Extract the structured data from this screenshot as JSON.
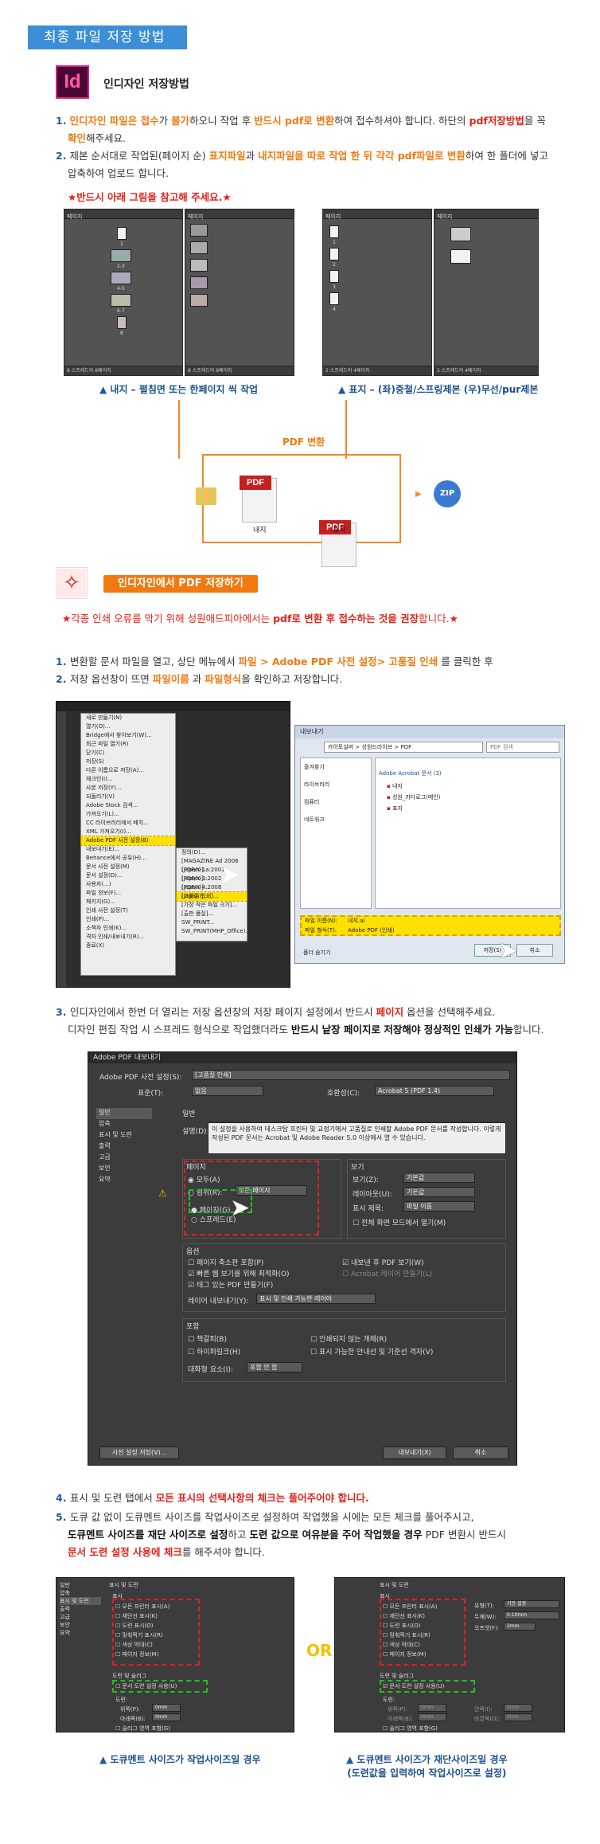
{
  "header": {
    "title": "최종 파일 저장 방법"
  },
  "section1": {
    "logo_text": "Id",
    "title": "인디자인 저장방법",
    "items": [
      {
        "num": "1.",
        "p1": "인디자인 파일은 접수",
        "p2": "가 ",
        "p3": "불가",
        "p4": "하오니 작업 후 ",
        "p5": "반드시 pdf로 변환",
        "p6": "하여 접수하셔야 합니다. 하단의 ",
        "p7": "pdf저장방법",
        "p8": "을 꼭",
        "p9": "확인",
        "p10": "해주세요."
      },
      {
        "num": "2.",
        "p1": "제본 순서대로 작업된(페이지 순) ",
        "p2": "표지파일",
        "p3": "과 ",
        "p4": "내지파일을 따로 작업 한 뒤 각각 pdf파일로 변환",
        "p5": "하여 한 폴더에 넣고",
        "p6": "압축하여 업로드 합니다."
      }
    ],
    "note": "★반드시 아래 그림을 참고해 주세요.★",
    "panel_tab1": "페이지",
    "panel_tab2": "링크",
    "panel_footer_left": "8 스프레드의 8페이지",
    "panel_footer_right": "2 스프레드의 4페이지",
    "inner_pages": [
      "1",
      "2-3",
      "4-5",
      "6-7",
      "8"
    ],
    "cover_pages": [
      "1",
      "2",
      "3",
      "4"
    ],
    "caption_left_a": "▲ ",
    "caption_left_b": "내지",
    "caption_left_c": " – 펼침면 또는 한페이지 씩 작업",
    "caption_right_a": "▲ ",
    "caption_right_b": "표지",
    "caption_right_c": " – (좌)중철/스프링제본  (우)무선/pur제본",
    "convert_label": "PDF 변환",
    "pdf_tag": "PDF",
    "pdf1_label": "내지",
    "pdf2_label": "표지",
    "zip_label": "ZIP"
  },
  "section2": {
    "title": "인디자인에서 PDF 저장하기",
    "warn_a": "★각종 인쇄 오류를 막기 위해 성원애드피아에서는 ",
    "warn_b": "pdf로 변환 후 접수하는 것을 권장",
    "warn_c": "합니다.★",
    "step1_a": "1. ",
    "step1_b": "변환할 문서 파일을 열고, 상단 메뉴에서 ",
    "step1_c": "파일 > Adobe PDF 사전 설정> 고품질 인쇄",
    "step1_d": " 를  클릭한 후",
    "step2_a": "2. ",
    "step2_b": "저장 옵션창이 뜨면 ",
    "step2_c": "파일이름",
    "step2_d": " 과 ",
    "step2_e": "파일형식",
    "step2_f": "을 확인하고 저장합니다.",
    "menu_items": [
      "새로 만들기(N)",
      "열기(O)...",
      "Bridge에서 찾아보기(W)...",
      "최근 파일 열기(R)",
      "닫기(C)",
      "저장(S)",
      "다른 이름으로 저장(A)...",
      "체크인(I)...",
      "사본 저장(Y)...",
      "되돌리기(V)",
      "Adobe Stock 검색...",
      "가져오기(L)...",
      "CC 라이브러리에서 배치...",
      "XML 가져오기(I)...",
      "Adobe PDF 사전 설정(B)",
      "내보내기(E)...",
      "Behance에서 공유(H)...",
      "문서 사전 설정(M)",
      "문서 설정(D)...",
      "사용자(...)",
      "파일 정보(F)...",
      "패키지(G)...",
      "인쇄 사전 설정(T)",
      "인쇄(P)...",
      "소책자 인쇄(K)...",
      "격자 인쇄/내보내기(R)...",
      "종료(X)"
    ],
    "submenu_items": [
      "정의(D)...",
      "[MAGAZINE Ad 2006 (Japan)]...",
      "[PDF/X-1a:2001 (Japan)]...",
      "[PDF/X-3:2002 (Japan)]...",
      "[PDF/X-4:2008 (Japan)]...",
      "[고품질 인쇄]...",
      "[가장 작은 파일 크기]...",
      "[출판 품질]...",
      "SW_PRINT...",
      "SW_PRINT(MHP_Office)..."
    ],
    "save_title": "내보내기",
    "save_path": "카이토실버 > 성원드라이브 > PDF",
    "save_search": "PDF 검색",
    "save_sidebar": [
      "즐겨찾기",
      "라이브러리",
      "컴퓨터",
      "네트워크"
    ],
    "save_group": "Adobe Acrobat 문서 (3)",
    "save_files": [
      "내지",
      "성원_카다로그(메인)",
      "표지"
    ],
    "filename_label": "파일 이름(N):",
    "filename_value": "내지.ai",
    "filetype_label": "파일 형식(T):",
    "filetype_value": "Adobe PDF (인쇄)",
    "save_btn": "저장(S)",
    "cancel_btn": "취소",
    "hide_folders": "폴더 숨기기"
  },
  "section3": {
    "step3_a": "3. ",
    "step3_b": "인디자인에서 한번 더 열리는 저장 옵션창의 저장 페이지 설정에서 반드시 ",
    "step3_c": "페이지",
    "step3_d": " 옵션을 선택해주세요.",
    "step3_e": "디자인 편집 작업 시 스프레드 형식으로 작업했더라도 ",
    "step3_f": "반드시 낱장 페이지로 저장해야 정상적인 인쇄가 가능",
    "step3_g": "합니다.",
    "dlg_title": "Adobe PDF 내보내기",
    "preset_label": "Adobe PDF 사전 설정(S):",
    "preset_value": "[고품질 인쇄]",
    "standard_label": "표준(T):",
    "standard_value": "없음",
    "compat_label": "호환성(C):",
    "compat_value": "Acrobat 5 (PDF 1.4)",
    "nav": [
      "일반",
      "압축",
      "표시 및 도련",
      "출력",
      "고급",
      "보안",
      "요약"
    ],
    "general_head": "일반",
    "desc_label": "설명(D):",
    "desc_text": "이 설정을 사용하여 데스크탑 프린터 및 교정기에서 고품질로 인쇄할 Adobe PDF 문서를 작성합니다. 이렇게 작성된 PDF 문서는 Acrobat 및 Adobe Reader 5.0 이상에서 열 수 있습니다.",
    "pages_head": "페이지",
    "all_label": "모두(A)",
    "range_label": "범위(R):",
    "range_value": "모든 페이지",
    "pages_opt": "페이지(G)",
    "spreads_opt": "스프레드(E)",
    "view_head": "보기",
    "view_label": "보기(Z):",
    "view_value": "기본값",
    "layout_label": "레이아웃(U):",
    "layout_value": "기본값",
    "show_title_label": "표시 제목:",
    "show_title_value": "파일 이름",
    "fullscreen": "전체 화면 모드에서 열기(M)",
    "options_head": "옵션",
    "opt1": "페이지 축소판 포함(P)",
    "opt2": "빠른 웹 보기를 위해 최적화(O)",
    "opt3": "태그 있는 PDF 만들기(F)",
    "opt4": "내보낸 후 PDF 보기(W)",
    "opt5": "Acrobat 레이어 만들기(L)",
    "layer_label": "레이어 내보내기(Y):",
    "layer_value": "표시 및 인쇄 가능한 레이어",
    "include_head": "포함",
    "inc1": "책갈피(B)",
    "inc2": "하이퍼링크(H)",
    "inc3": "인쇄되지 않는 개체(R)",
    "inc4": "표시 가능한 안내선 및 기준선 격자(V)",
    "interactive_label": "대화형 요소(I):",
    "interactive_value": "포함 안 함",
    "save_preset_btn": "사전 설정 저장(V)...",
    "export_btn": "내보내기(X)",
    "cancel_btn": "취소"
  },
  "section4": {
    "step4_a": "4. ",
    "step4_b": "표시 및 도련 탭에서 ",
    "step4_c": "모든 표시의 선택사항의 체크는 풀어주어야 합니다.",
    "step5_a": "5. ",
    "step5_b": "도큐 값 없이 도큐멘트 사이즈를 작업사이즈로 설정하여 작업했을 시에는 모든 체크를 풀어주시고,",
    "step5_c": "도큐멘트 사이즈를 재단 사이즈로 설정",
    "step5_d": "하고 ",
    "step5_e": "도련 값으로 여유분을 주어 작업했을 경우",
    "step5_f": " PDF 변환시 반드시",
    "step5_g": "문서 도련 설정 사용에 체크",
    "step5_h": "를 해주셔야 합니다.",
    "nav": [
      "일반",
      "압축",
      "표시 및 도련",
      "출력",
      "고급",
      "보안",
      "요약"
    ],
    "tab_head": "표시 및 도련",
    "marks_head": "표시",
    "marks": [
      "모든 프린터 표시(A)",
      "재단선 표시(K)",
      "도련 표시(O)",
      "맞춰찍기 표시(R)",
      "색상 막대(C)",
      "페이지 정보(M)"
    ],
    "type_label": "유형(T):",
    "type_value": "기본 설정",
    "weight_label": "두께(W):",
    "weight_value": "0.10mm",
    "offset_label": "오프셋(F):",
    "offset_value": "2mm",
    "bleed_head": "도련 및 슬러그",
    "bleed_check": "문서 도련 설정 사용(U)",
    "bleed_sub": "도련:",
    "top_label": "위쪽(P):",
    "bottom_label": "아래쪽(B):",
    "inner_label": "안쪽(I):",
    "outer_label": "바깥쪽(O):",
    "zero": "0mm",
    "slug": "슬러그 영역 포함(G)",
    "or": "OR",
    "cap_left_a": "▲ ",
    "cap_left_b": "도큐멘트 사이즈가 작업사이즈일 경우",
    "cap_right_a": "▲ ",
    "cap_right_b": "도큐멘트 사이즈가 재단사이즈일 경우",
    "cap_right_c": "(도련값을 입력하여 작업사이즈로 설정)"
  },
  "colors": {
    "accent_blue": "#3c8fd6",
    "red": "#e2231a",
    "orange": "#f07a10",
    "navy": "#1e5aa8"
  }
}
